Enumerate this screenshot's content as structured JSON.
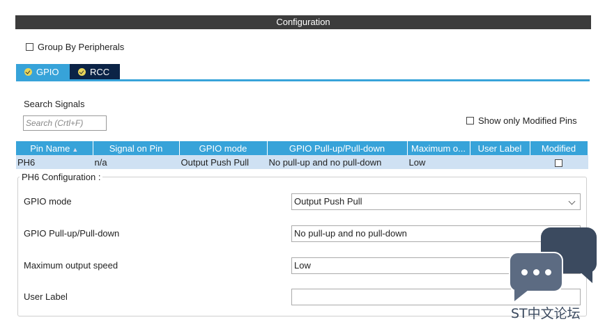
{
  "window": {
    "title": "Configuration"
  },
  "group_by": {
    "label": "Group By Peripherals",
    "checked": false
  },
  "tabs": [
    {
      "label": "GPIO",
      "active": true,
      "icon": "check-circle-icon"
    },
    {
      "label": "RCC",
      "active": false,
      "icon": "check-circle-icon"
    }
  ],
  "search": {
    "label": "Search Signals",
    "placeholder": "Search (Crtl+F)",
    "value": ""
  },
  "show_modified": {
    "label": "Show only Modified Pins",
    "checked": false
  },
  "table": {
    "columns": [
      "Pin Name",
      "Signal on Pin",
      "GPIO mode",
      "GPIO Pull-up/Pull-down",
      "Maximum o...",
      "User Label",
      "Modified"
    ],
    "rows": [
      {
        "pin": "PH6",
        "signal": "n/a",
        "mode": "Output Push Pull",
        "pull": "No pull-up and no pull-down",
        "speed": "Low",
        "user_label": "",
        "modified": false
      }
    ]
  },
  "config": {
    "legend": "PH6 Configuration :",
    "gpio_mode": {
      "label": "GPIO mode",
      "value": "Output Push Pull"
    },
    "pull": {
      "label": "GPIO Pull-up/Pull-down",
      "value": "No pull-up and no pull-down"
    },
    "speed": {
      "label": "Maximum output speed",
      "value": "Low"
    },
    "user_label": {
      "label": "User Label",
      "value": ""
    }
  },
  "watermark": {
    "text": "ST中文论坛"
  },
  "colors": {
    "accent": "#37a3d9",
    "dark_tab": "#0b2346",
    "row_bg": "#cfe1f3",
    "titlebar": "#3c3c3c"
  }
}
